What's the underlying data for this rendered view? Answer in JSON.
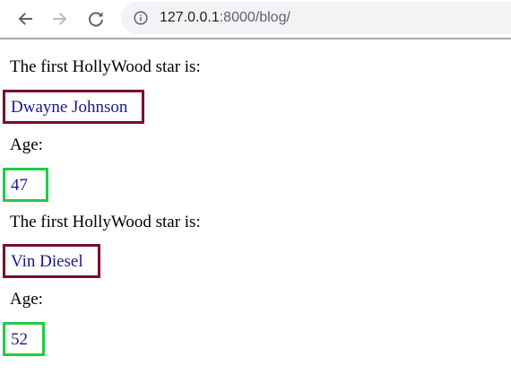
{
  "browser": {
    "url_host": "127.0.0.1",
    "url_rest": ":8000/blog/",
    "icons": {
      "back": "back-arrow-icon",
      "forward": "forward-arrow-icon",
      "reload": "reload-icon",
      "info": "info-icon"
    }
  },
  "page": {
    "entries": [
      {
        "heading": "The first HollyWood star is:",
        "name": "Dwayne Johnson",
        "age_label": "Age:",
        "age": "47"
      },
      {
        "heading": "The first HollyWood star is:",
        "name": "Vin Diesel",
        "age_label": "Age:",
        "age": "52"
      }
    ]
  },
  "colors": {
    "name_border": "#7b0a2a",
    "age_border": "#1fcc4a",
    "value_text": "#1a1a8c"
  }
}
